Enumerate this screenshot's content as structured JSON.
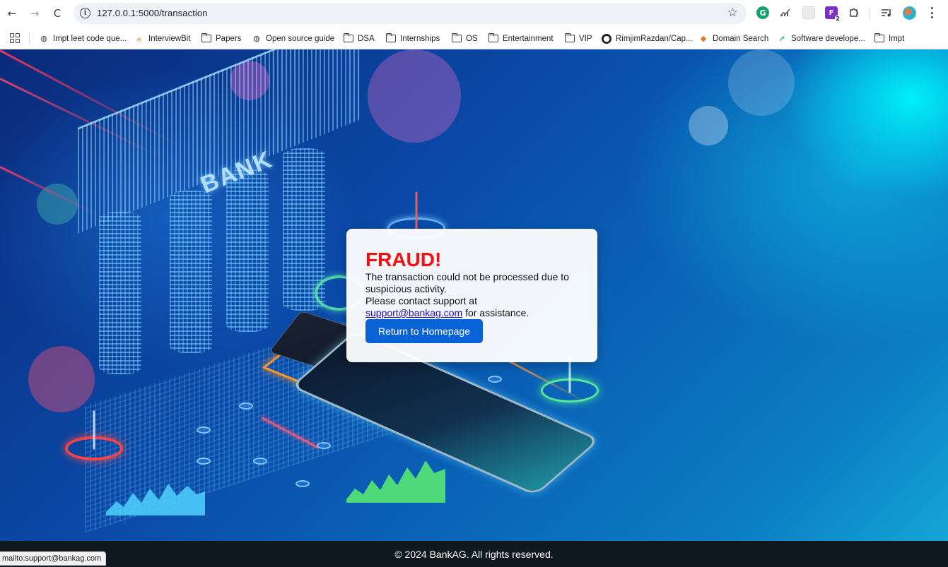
{
  "browser": {
    "url": "127.0.0.1:5000/transaction",
    "back_glyph": "←",
    "forward_glyph": "→",
    "reload_glyph": "C",
    "info_glyph": "i",
    "star_glyph": "☆",
    "extensions": [
      {
        "name": "grammarly-extension",
        "glyph": "G"
      },
      {
        "name": "chart-extension",
        "glyph": "📶"
      },
      {
        "name": "blank-extension",
        "glyph": ""
      },
      {
        "name": "purple-extension",
        "glyph": "F",
        "badge": "2"
      },
      {
        "name": "puzzle-extension",
        "glyph": "⧉"
      },
      {
        "name": "media-control",
        "glyph": "≡"
      }
    ]
  },
  "bookmarks": [
    {
      "label": "Impt leet code que...",
      "icon": "globe-icon"
    },
    {
      "label": "InterviewBit",
      "icon": "interviewbit-icon"
    },
    {
      "label": "Papers",
      "icon": "folder-icon"
    },
    {
      "label": "Open source guide",
      "icon": "globe-icon"
    },
    {
      "label": "DSA",
      "icon": "folder-icon"
    },
    {
      "label": "Internships",
      "icon": "folder-icon"
    },
    {
      "label": "OS",
      "icon": "folder-icon"
    },
    {
      "label": "Entertainment",
      "icon": "folder-icon"
    },
    {
      "label": "VIP",
      "icon": "folder-icon"
    },
    {
      "label": "RimjimRazdan/Cap...",
      "icon": "github-icon"
    },
    {
      "label": "Domain Search",
      "icon": "domain-search-icon"
    },
    {
      "label": "Software develope...",
      "icon": "software-icon"
    },
    {
      "label": "Impt",
      "icon": "folder-icon"
    }
  ],
  "hero": {
    "bank_sign": "BANK"
  },
  "alert": {
    "title": "FRAUD!",
    "line1": "The transaction could not be processed due to suspicious activity.",
    "line2": "Please contact support at",
    "email": "support@bankag.com",
    "line3": " for assistance.",
    "button_label": "Return to Homepage"
  },
  "footer": {
    "text": "© 2024 BankAG. All rights reserved."
  },
  "status_bar": {
    "text": "mailto:support@bankag.com"
  },
  "colors": {
    "alert_title": "#f31010",
    "button": "#0a63d6",
    "footer_bg": "#101820"
  }
}
